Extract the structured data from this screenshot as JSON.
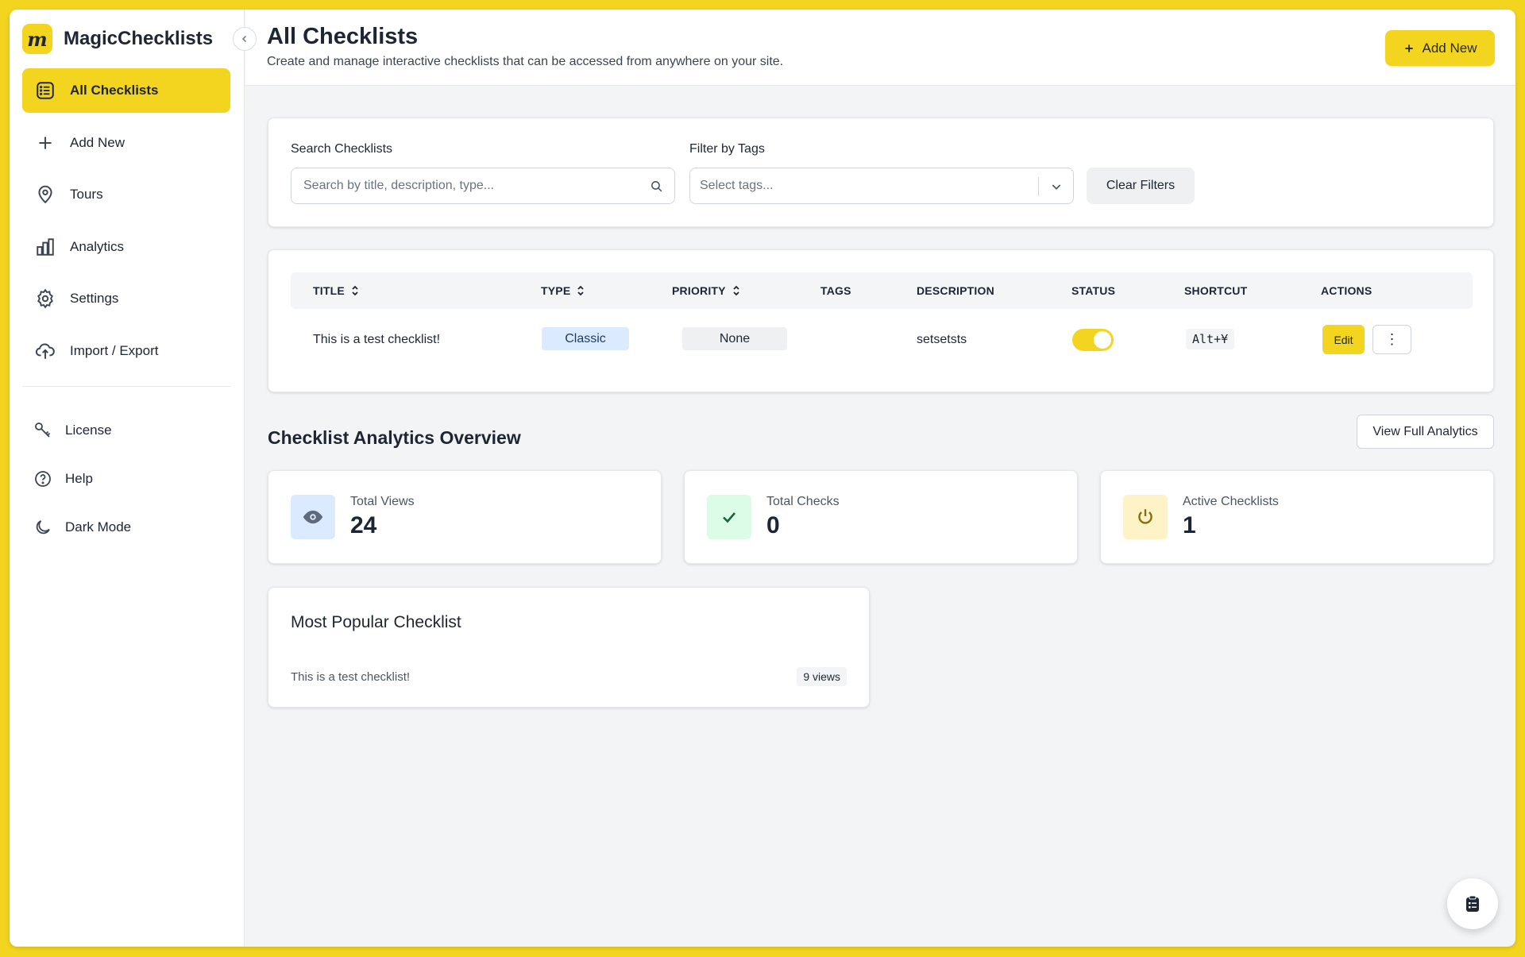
{
  "app": {
    "name": "MagicChecklists",
    "logo_letter": "m"
  },
  "sidebar": {
    "items": [
      {
        "label": "All Checklists",
        "icon": "list-icon",
        "active": true
      },
      {
        "label": "Add New",
        "icon": "plus-icon"
      },
      {
        "label": "Tours",
        "icon": "map-pin-icon"
      },
      {
        "label": "Analytics",
        "icon": "bar-chart-icon"
      },
      {
        "label": "Settings",
        "icon": "gear-icon"
      },
      {
        "label": "Import / Export",
        "icon": "upload-cloud-icon"
      }
    ],
    "secondary": [
      {
        "label": "License",
        "icon": "key-icon"
      },
      {
        "label": "Help",
        "icon": "help-circle-icon"
      },
      {
        "label": "Dark Mode",
        "icon": "moon-icon"
      }
    ]
  },
  "header": {
    "title": "All Checklists",
    "subtitle": "Create and manage interactive checklists that can be accessed from anywhere on your site.",
    "add_button": "Add New"
  },
  "filters": {
    "search_label": "Search Checklists",
    "search_placeholder": "Search by title, description, type...",
    "tags_label": "Filter by Tags",
    "tags_placeholder": "Select tags...",
    "clear_button": "Clear Filters"
  },
  "table": {
    "columns": [
      "TITLE",
      "TYPE",
      "PRIORITY",
      "TAGS",
      "DESCRIPTION",
      "STATUS",
      "SHORTCUT",
      "ACTIONS"
    ],
    "rows": [
      {
        "title": "This is a test checklist!",
        "type": "Classic",
        "priority": "None",
        "tags": "",
        "description": "setsetsts",
        "status_on": true,
        "shortcut": "Alt+¥",
        "edit_label": "Edit",
        "more_label": "⋮"
      }
    ]
  },
  "analytics": {
    "title": "Checklist Analytics Overview",
    "view_button": "View Full Analytics",
    "stats": [
      {
        "label": "Total Views",
        "value": "24",
        "icon": "eye-icon",
        "color": "#dbeafe"
      },
      {
        "label": "Total Checks",
        "value": "0",
        "icon": "check-icon",
        "color": "#dcfce7"
      },
      {
        "label": "Active Checklists",
        "value": "1",
        "icon": "power-icon",
        "color": "#fef3c7"
      }
    ],
    "popular": {
      "title": "Most Popular Checklist",
      "name": "This is a test checklist!",
      "views": "9 views"
    }
  },
  "colors": {
    "accent": "#f3d51f",
    "text": "#1e2633",
    "background": "#f3f4f6"
  }
}
